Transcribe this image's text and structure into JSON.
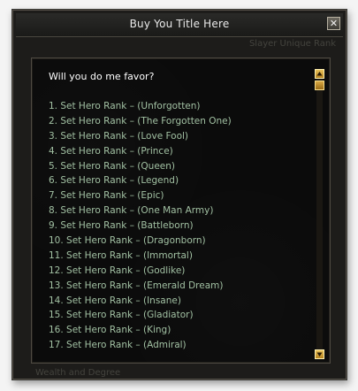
{
  "window": {
    "title": "Buy You Title Here",
    "close_icon": "close-icon",
    "ghost_top": "Slayer Unique Rank",
    "ghost_bottom": "Wealth and Degree"
  },
  "dialog": {
    "prompt": "Will you do me favor?",
    "options": [
      "1. Set Hero Rank – (Unforgotten)",
      "2. Set Hero Rank – (The Forgotten One)",
      "3. Set Hero Rank – (Love Fool)",
      "4. Set Hero Rank – (Prince)",
      "5. Set Hero Rank – (Queen)",
      "6. Set Hero Rank – (Legend)",
      "7. Set Hero Rank – (Epic)",
      "8. Set Hero Rank – (One Man Army)",
      "9. Set Hero Rank – (Battleborn)",
      "10. Set Hero Rank – (Dragonborn)",
      "11. Set Hero Rank – (Immortal)",
      "12. Set Hero Rank – (Godlike)",
      "13. Set Hero Rank – (Emerald Dream)",
      "14. Set Hero Rank – (Insane)",
      "15. Set Hero Rank – (Gladiator)",
      "16. Set Hero Rank – (King)",
      "17. Set Hero Rank – (Admiral)"
    ]
  },
  "scrollbar": {
    "up_icon": "scroll-up-icon",
    "down_icon": "scroll-down-icon"
  },
  "colors": {
    "option_text": "#a2c1a3",
    "prompt_text": "#ffffff",
    "scroll_accent": "#d8a844"
  }
}
